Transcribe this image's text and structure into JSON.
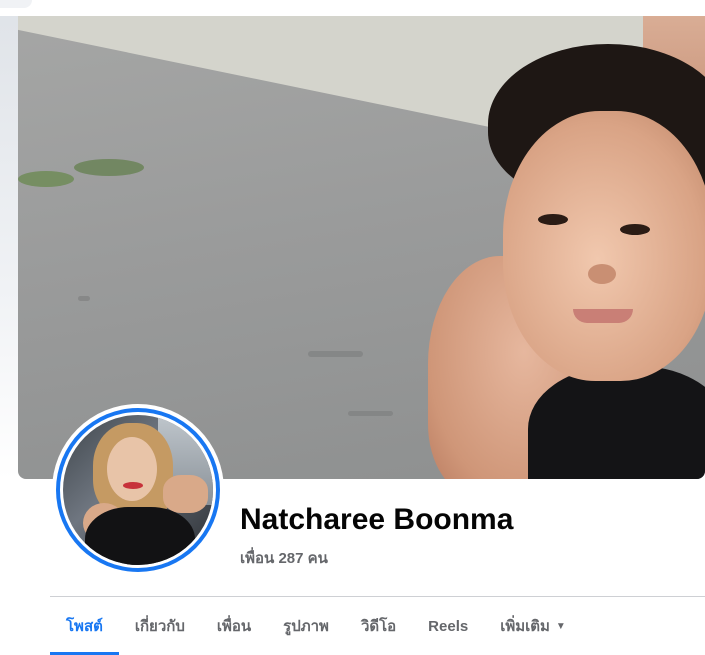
{
  "profile": {
    "name": "Natcharee Boonma",
    "friends_count": "เพื่อน 287 คน"
  },
  "tabs": [
    {
      "label": "โพสต์",
      "active": true
    },
    {
      "label": "เกี่ยวกับ",
      "active": false
    },
    {
      "label": "เพื่อน",
      "active": false
    },
    {
      "label": "รูปภาพ",
      "active": false
    },
    {
      "label": "วิดีโอ",
      "active": false
    },
    {
      "label": "Reels",
      "active": false
    },
    {
      "label": "เพิ่มเติม",
      "active": false,
      "dropdown": true
    }
  ],
  "colors": {
    "accent": "#1877f2",
    "text_primary": "#050505",
    "text_secondary": "#65676b",
    "divider": "#ced0d4"
  },
  "icons": {
    "more_dropdown": "caret-down-icon"
  }
}
